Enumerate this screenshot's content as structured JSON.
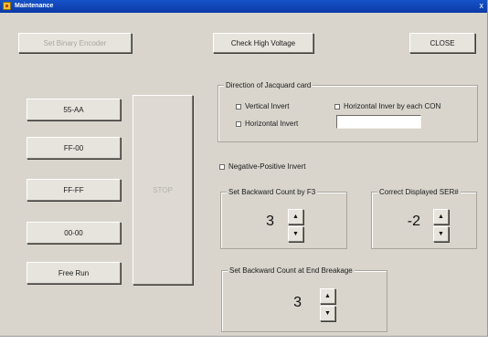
{
  "window": {
    "title": "Maintenance",
    "close_glyph": "x"
  },
  "buttons": {
    "set_binary_encoder": "Set Binary Encoder",
    "check_high_voltage": "Check High Voltage",
    "close": "CLOSE",
    "b55aa": "55-AA",
    "ff00": "FF-00",
    "ffff": "FF-FF",
    "b0000": "00-00",
    "free_run": "Free Run",
    "stop": "STOP"
  },
  "direction_group": {
    "title": "Direction of Jacquard card",
    "vertical_invert": "Vertical Invert",
    "horizontal_invert_each_con": "Horizontal Inver by each CON",
    "horizontal_invert": "Horizontal Invert",
    "con_field_value": ""
  },
  "negative_positive_invert": "Negative-Positive Invert",
  "backward_f3": {
    "title": "Set Backward Count by F3",
    "value": "3"
  },
  "correct_ser": {
    "title": "Correct Displayed SER#",
    "value": "-2"
  },
  "end_breakage": {
    "title": "Set Backward Count at End Breakage",
    "value": "3"
  },
  "spin_glyphs": {
    "up": "▲",
    "down": "▼"
  },
  "colors": {
    "titlebar": "#1652c8",
    "face": "#d9d5cd",
    "button": "#e7e4dd"
  }
}
